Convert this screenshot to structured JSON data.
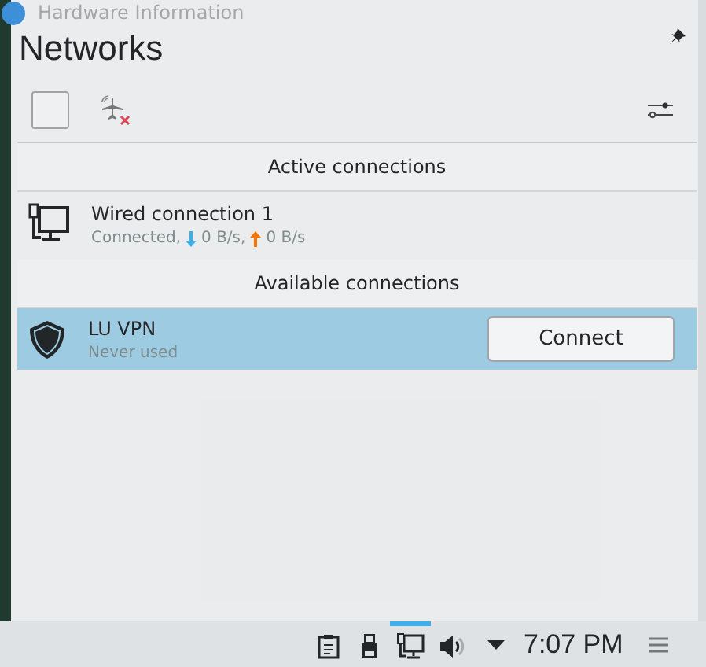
{
  "background_window": {
    "title": "Hardware Information"
  },
  "popup": {
    "title": "Networks",
    "wireless_enabled": false
  },
  "sections": [
    {
      "header": "Active connections",
      "connections": [
        {
          "kind": "wired",
          "name": "Wired connection 1",
          "selected": false,
          "status": "Connected,",
          "down": "0 B/s,",
          "up": "0 B/s"
        }
      ]
    },
    {
      "header": "Available connections",
      "connections": [
        {
          "kind": "vpn",
          "name": "LU VPN",
          "selected": true,
          "status": "Never used",
          "action": "Connect"
        }
      ]
    }
  ],
  "taskbar": {
    "tray": [
      {
        "kind": "clipboard",
        "active": false
      },
      {
        "kind": "usb",
        "active": false
      },
      {
        "kind": "network",
        "active": true
      },
      {
        "kind": "volume",
        "active": false
      }
    ],
    "clock": "7:07 PM"
  }
}
